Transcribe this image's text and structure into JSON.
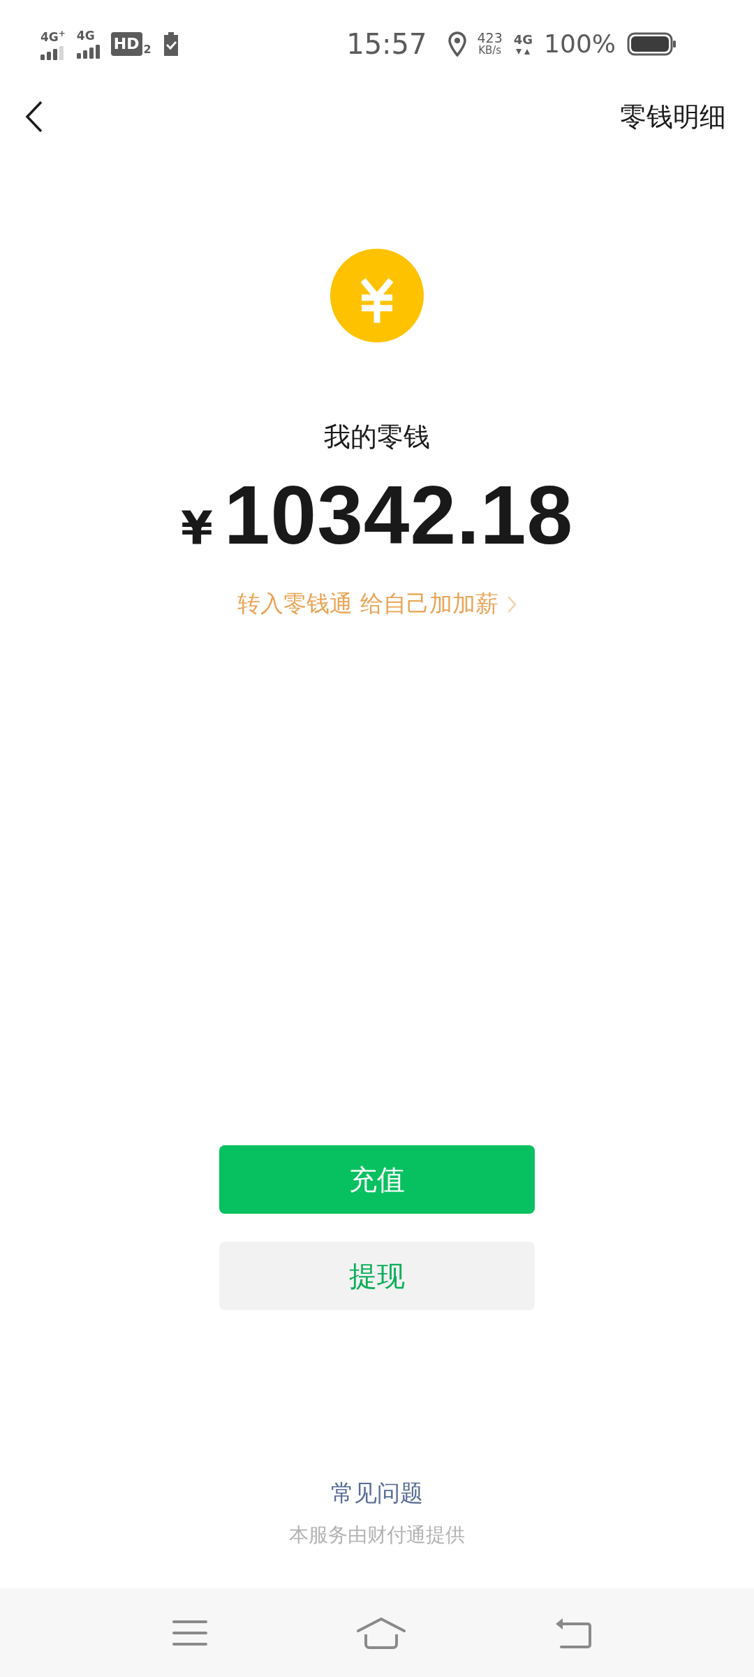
{
  "status_bar": {
    "networks": [
      {
        "label": "4G$^{+}$"
      },
      {
        "label": "4G"
      }
    ],
    "hd": "HD",
    "hd_sub": "2",
    "time": "15:57",
    "speed_value": "423",
    "speed_unit": "KB/s",
    "data_network": "4G",
    "battery": "100%"
  },
  "nav": {
    "title": "零钱明细"
  },
  "balance": {
    "label": "我的零钱",
    "currency": "¥",
    "amount": "10342.18",
    "promo": "转入零钱通 给自己加加薪"
  },
  "buttons": [
    {
      "label": "充值",
      "kind": "primary"
    },
    {
      "label": "提现",
      "kind": "secondary"
    }
  ],
  "footer": {
    "faq": "常见问题",
    "provider": "本服务由财付通提供"
  }
}
